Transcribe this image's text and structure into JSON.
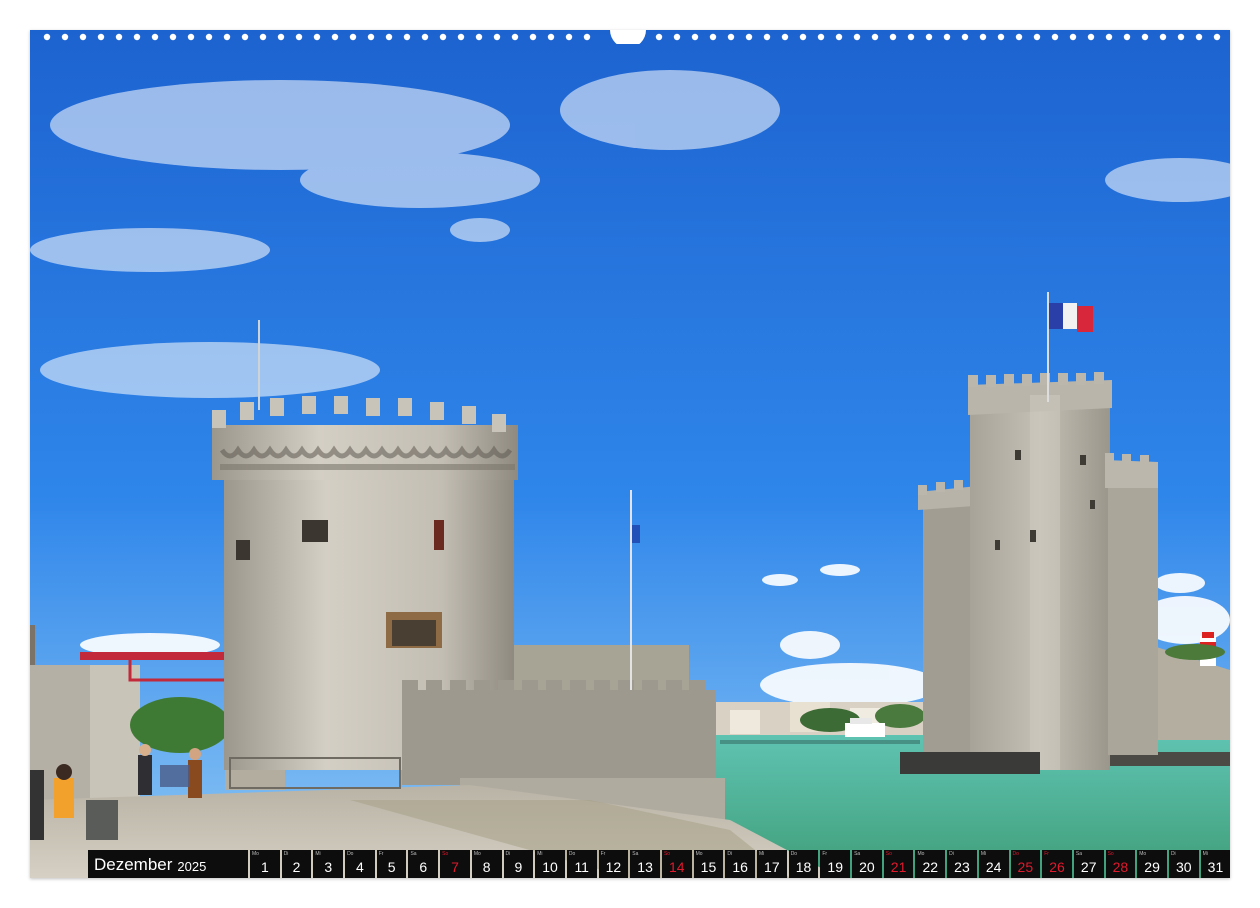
{
  "calendar": {
    "month": "Dezember",
    "year": "2025",
    "days": [
      {
        "wd": "Mo",
        "n": "1",
        "red": false
      },
      {
        "wd": "Di",
        "n": "2",
        "red": false
      },
      {
        "wd": "Mi",
        "n": "3",
        "red": false
      },
      {
        "wd": "Do",
        "n": "4",
        "red": false
      },
      {
        "wd": "Fr",
        "n": "5",
        "red": false
      },
      {
        "wd": "Sa",
        "n": "6",
        "red": false
      },
      {
        "wd": "So",
        "n": "7",
        "red": true
      },
      {
        "wd": "Mo",
        "n": "8",
        "red": false
      },
      {
        "wd": "Di",
        "n": "9",
        "red": false
      },
      {
        "wd": "Mi",
        "n": "10",
        "red": false
      },
      {
        "wd": "Do",
        "n": "11",
        "red": false
      },
      {
        "wd": "Fr",
        "n": "12",
        "red": false
      },
      {
        "wd": "Sa",
        "n": "13",
        "red": false
      },
      {
        "wd": "So",
        "n": "14",
        "red": true
      },
      {
        "wd": "Mo",
        "n": "15",
        "red": false
      },
      {
        "wd": "Di",
        "n": "16",
        "red": false
      },
      {
        "wd": "Mi",
        "n": "17",
        "red": false
      },
      {
        "wd": "Do",
        "n": "18",
        "red": false
      },
      {
        "wd": "Fr",
        "n": "19",
        "red": false
      },
      {
        "wd": "Sa",
        "n": "20",
        "red": false
      },
      {
        "wd": "So",
        "n": "21",
        "red": true
      },
      {
        "wd": "Mo",
        "n": "22",
        "red": false
      },
      {
        "wd": "Di",
        "n": "23",
        "red": false
      },
      {
        "wd": "Mi",
        "n": "24",
        "red": false
      },
      {
        "wd": "Do",
        "n": "25",
        "red": true
      },
      {
        "wd": "Fr",
        "n": "26",
        "red": true
      },
      {
        "wd": "Sa",
        "n": "27",
        "red": false
      },
      {
        "wd": "So",
        "n": "28",
        "red": true
      },
      {
        "wd": "Mo",
        "n": "29",
        "red": false
      },
      {
        "wd": "Di",
        "n": "30",
        "red": false
      },
      {
        "wd": "Mi",
        "n": "31",
        "red": false
      }
    ]
  },
  "colors": {
    "sky_top": "#1f6fd9",
    "sky_bottom": "#4aa0f0",
    "stone": "#bdb8ad",
    "water": "#4fb39a",
    "holiday_red": "#e0192d",
    "bar_bg": "#0d0d0d"
  },
  "photo_subject": "tower-of-la-chaine-and-saint-nicolas-tower"
}
